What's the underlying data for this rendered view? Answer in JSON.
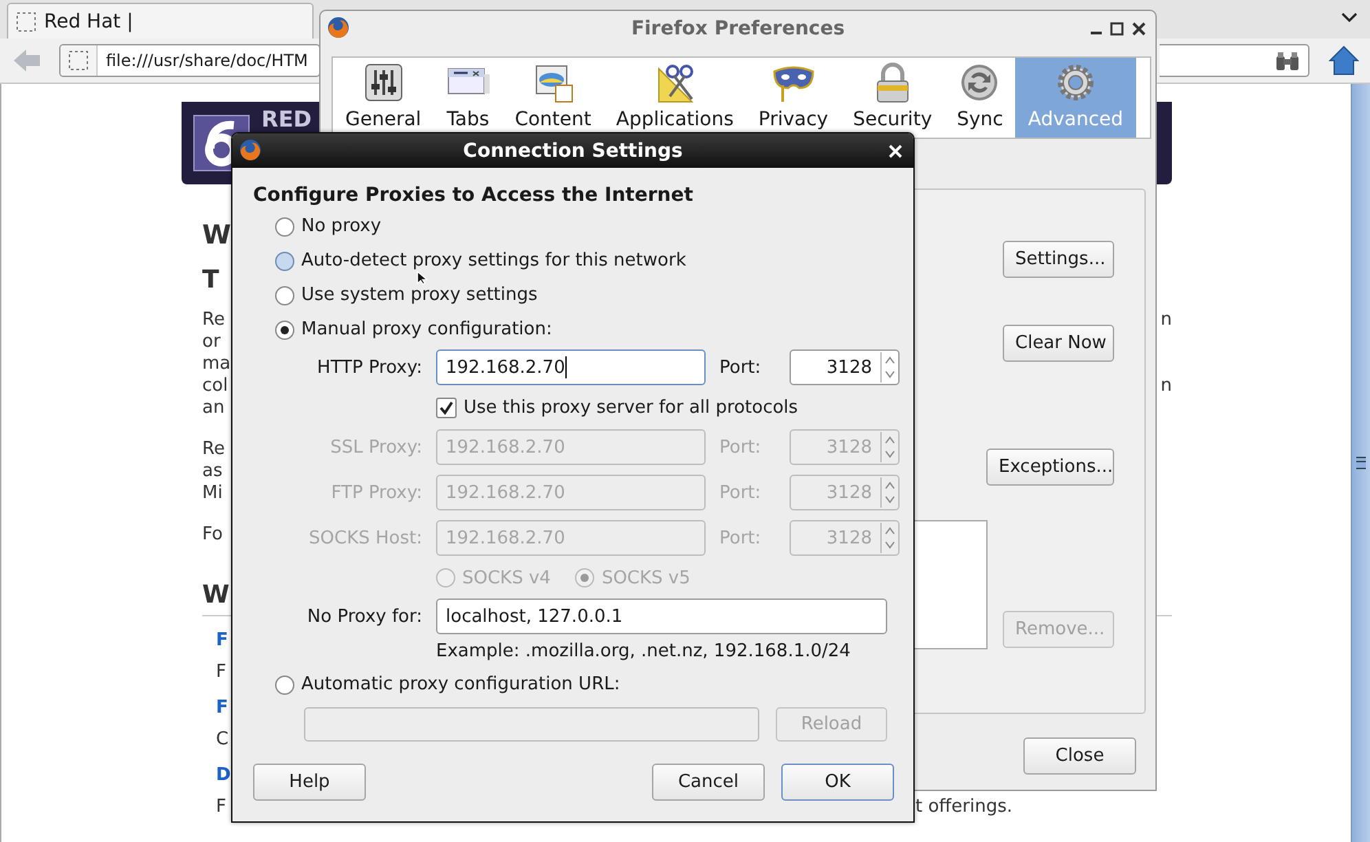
{
  "browser": {
    "tab_title": "Red Hat |",
    "address": "file:///usr/share/doc/HTM",
    "page": {
      "banner_text": "RED",
      "title": "W",
      "subtitle": "T",
      "paragraphs": [
        [
          {
            "left": "Re",
            "right": "n"
          },
          {
            "left": "or"
          },
          {
            "left": "ma"
          },
          {
            "left": "col",
            "right": "n"
          },
          {
            "left": "an"
          }
        ],
        [
          {
            "left": "Re"
          },
          {
            "left": "as"
          },
          {
            "left": "Mi"
          }
        ],
        [
          {
            "left": "Fo"
          }
        ]
      ],
      "section": "W",
      "links": [
        {
          "title": "F",
          "desc": "F"
        },
        {
          "title": "F",
          "desc": "C"
        },
        {
          "title": "D",
          "desc": "F",
          "desc_right": "t offerings."
        }
      ]
    }
  },
  "preferences": {
    "title": "Firefox Preferences",
    "panes": [
      {
        "label": "General",
        "kind": "general",
        "selected": false
      },
      {
        "label": "Tabs",
        "kind": "tabs",
        "selected": false
      },
      {
        "label": "Content",
        "kind": "content",
        "selected": false
      },
      {
        "label": "Applications",
        "kind": "applications",
        "selected": false
      },
      {
        "label": "Privacy",
        "kind": "privacy",
        "selected": false
      },
      {
        "label": "Security",
        "kind": "security",
        "selected": false
      },
      {
        "label": "Sync",
        "kind": "sync",
        "selected": false
      },
      {
        "label": "Advanced",
        "kind": "advanced",
        "selected": true
      }
    ],
    "buttons": [
      {
        "label": "Settings...",
        "disabled": false
      },
      {
        "label": "Clear Now",
        "disabled": false
      },
      {
        "label": "Exceptions...",
        "disabled": false
      },
      {
        "label": "Remove...",
        "disabled": true
      }
    ],
    "close_button": "Close"
  },
  "connection_dialog": {
    "title": "Connection Settings",
    "heading": "Configure Proxies to Access the Internet",
    "modes": [
      {
        "label": "No proxy",
        "selected": false,
        "hovered": false
      },
      {
        "label": "Auto-detect proxy settings for this network",
        "selected": false,
        "hovered": true
      },
      {
        "label": "Use system proxy settings",
        "selected": false,
        "hovered": false
      },
      {
        "label": "Manual proxy configuration:",
        "selected": true,
        "hovered": false
      }
    ],
    "proxies": [
      {
        "label": "HTTP Proxy:",
        "value": "192.168.2.70",
        "port_label": "Port:",
        "port": "3128",
        "disabled": false,
        "focused": true
      },
      {
        "label": "SSL Proxy:",
        "value": "192.168.2.70",
        "port_label": "Port:",
        "port": "3128",
        "disabled": true,
        "focused": false
      },
      {
        "label": "FTP Proxy:",
        "value": "192.168.2.70",
        "port_label": "Port:",
        "port": "3128",
        "disabled": true,
        "focused": false
      },
      {
        "label": "SOCKS Host:",
        "value": "192.168.2.70",
        "port_label": "Port:",
        "port": "3128",
        "disabled": true,
        "focused": false
      }
    ],
    "share_all": {
      "label": "Use this proxy server for all protocols",
      "checked": true
    },
    "socks_versions": [
      {
        "label": "SOCKS v4",
        "selected": false
      },
      {
        "label": "SOCKS v5",
        "selected": true
      }
    ],
    "socks_disabled": true,
    "no_proxy": {
      "label": "No Proxy for:",
      "value": "localhost, 127.0.0.1",
      "example": "Example: .mozilla.org, .net.nz, 192.168.1.0/24"
    },
    "auto_config": {
      "label": "Automatic proxy configuration URL:",
      "selected": false,
      "reload_button": "Reload",
      "reload_disabled": true
    },
    "buttons": [
      {
        "label": "Help",
        "default": false
      },
      {
        "label": "Cancel",
        "default": false
      },
      {
        "label": "OK",
        "default": true
      }
    ]
  }
}
